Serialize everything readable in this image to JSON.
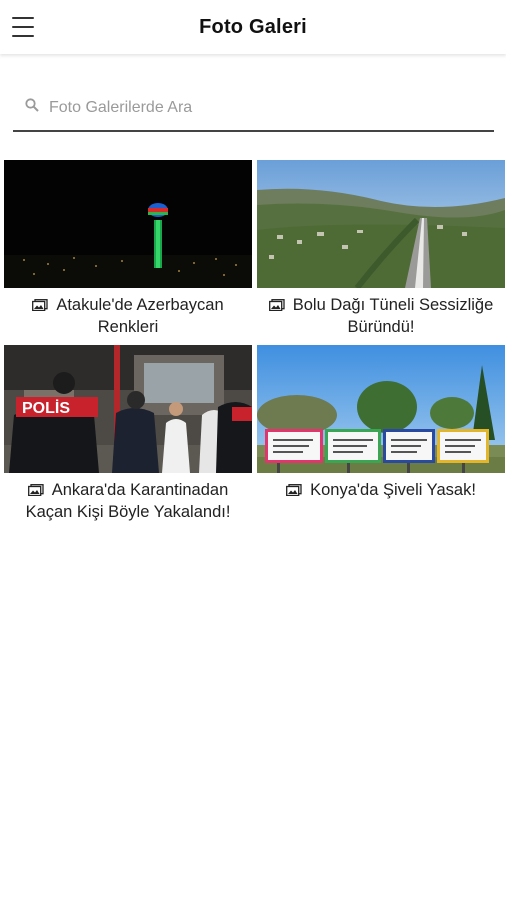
{
  "header": {
    "title": "Foto Galeri",
    "menu_icon": "hamburger-menu-icon"
  },
  "search": {
    "placeholder": "Foto Galerilerde Ara",
    "value": "",
    "icon": "search-icon"
  },
  "gallery": [
    {
      "caption": "Atakule'de Azerbaycan Renkleri",
      "icon": "image-gallery-icon"
    },
    {
      "caption": "Bolu Dağı Tüneli Sessizliğe Büründü!",
      "icon": "image-gallery-icon"
    },
    {
      "caption": "Ankara'da Karantinadan Kaçan Kişi Böyle Yakalandı!",
      "icon": "image-gallery-icon"
    },
    {
      "caption": "Konya'da Şiveli Yasak!",
      "icon": "image-gallery-icon"
    }
  ],
  "photo_text": {
    "police_vest": "POLİS"
  }
}
